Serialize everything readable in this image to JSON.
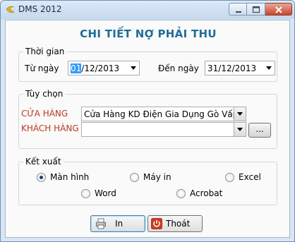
{
  "window": {
    "title": "DMS 2012",
    "icons": {
      "app": "dms-app-icon",
      "minimize": "minimize-icon",
      "maximize": "maximize-icon",
      "close": "close-icon"
    }
  },
  "heading": "CHI TIẾT NỢ PHẢI THU",
  "time_group": {
    "legend": "Thời gian",
    "from_label": "Từ ngày",
    "from_value_selected": "01",
    "from_value_rest": "/12/2013",
    "to_label": "Đến ngày",
    "to_value": "31/12/2013"
  },
  "options_group": {
    "legend": "Tùy chọn",
    "store_label": "CỬA HÀNG",
    "store_value": "Cửa Hàng KD Điện Gia Dụng Gò Vấp",
    "customer_label": "KHÁCH HÀNG",
    "customer_value": "",
    "browse_label": "...",
    "label_color": "#b73a1e"
  },
  "export_group": {
    "legend": "Kết xuất",
    "options": [
      {
        "label": "Màn hình",
        "selected": true
      },
      {
        "label": "Máy in",
        "selected": false
      },
      {
        "label": "Excel",
        "selected": false
      },
      {
        "label": "Word",
        "selected": false
      },
      {
        "label": "Acrobat",
        "selected": false
      }
    ]
  },
  "actions": {
    "print_label": "In",
    "print_icon": "printer-icon",
    "exit_label": "Thoát",
    "exit_icon": "power-icon"
  },
  "colors": {
    "heading": "#1f6e98",
    "window_frame": "#d8e6f4",
    "accent_select": "#3399ff"
  }
}
